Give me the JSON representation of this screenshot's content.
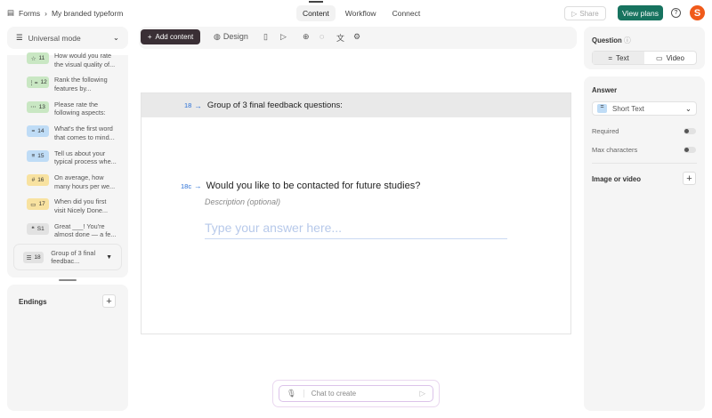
{
  "breadcrumb": {
    "root": "Forms",
    "current": "My branded typeform"
  },
  "nav_tabs": [
    {
      "label": "Content"
    },
    {
      "label": "Workflow"
    },
    {
      "label": "Connect"
    }
  ],
  "header": {
    "share": "Share",
    "view_plans": "View plans",
    "help": "?",
    "logo": "S"
  },
  "mode": {
    "label": "Universal mode"
  },
  "toolbar": {
    "add_content": "Add content",
    "design": "Design"
  },
  "questions": [
    {
      "num": "11",
      "text": "How would you rate the visual quality of...",
      "color": "g",
      "icon": "☆"
    },
    {
      "num": "12",
      "text": "Rank the following features by...",
      "color": "g",
      "icon": "⋮="
    },
    {
      "num": "13",
      "text": "Please rate the following aspects:",
      "color": "g",
      "icon": "⋯"
    },
    {
      "num": "14",
      "text": "What's the first word that comes to mind...",
      "color": "b",
      "icon": "="
    },
    {
      "num": "15",
      "text": "Tell us about your typical process whe...",
      "color": "b",
      "icon": "≡"
    },
    {
      "num": "16",
      "text": "On average, how many hours per we...",
      "color": "y",
      "icon": "#"
    },
    {
      "num": "17",
      "text": "When did you first visit Nicely Done...",
      "color": "y",
      "icon": "▭"
    },
    {
      "num": "S1",
      "text": "Great ___! You're almost done — a fe...",
      "color": "gr",
      "icon": "❝"
    }
  ],
  "selected_group": {
    "num": "18",
    "text": "Group of 3 final feedbac..."
  },
  "endings": {
    "label": "Endings"
  },
  "canvas": {
    "group_num": "18",
    "group_title": "Group of 3 final feedback questions:",
    "q_num": "18c",
    "q_title": "Would you like to be contacted for future studies?",
    "description": "Description (optional)",
    "answer_placeholder": "Type your answer here..."
  },
  "chat": {
    "placeholder": "Chat to create"
  },
  "right": {
    "question_label": "Question",
    "text_tab": "Text",
    "video_tab": "Video",
    "answer_label": "Answer",
    "answer_type": "Short Text",
    "required": "Required",
    "max_chars": "Max characters",
    "image_video": "Image or video"
  }
}
